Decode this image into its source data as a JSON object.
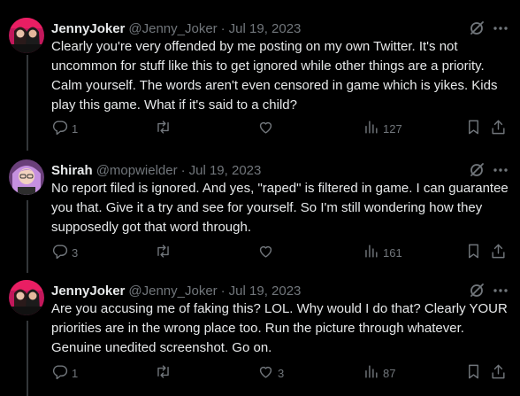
{
  "tweets": [
    {
      "display_name": "JennyJoker",
      "handle": "@Jenny_Joker",
      "separator": "·",
      "date": "Jul 19, 2023",
      "text": "Clearly you're very offended by me posting on my own Twitter. It's not uncommon for stuff like this to get ignored while other things are a priority. Calm yourself. The words aren't even censored in game which is yikes. Kids play this game. What if it's said to a child?",
      "replies": "1",
      "retweets": "",
      "likes": "",
      "views": "127",
      "avatar": "avatar-couple"
    },
    {
      "display_name": "Shirah",
      "handle": "@mopwielder",
      "separator": "·",
      "date": "Jul 19, 2023",
      "text": "No report filed is ignored. And yes, \"raped\" is filtered in game. I can guarantee you that. Give it a try and see for yourself. So I'm still wondering how they supposedly got that word through.",
      "replies": "3",
      "retweets": "",
      "likes": "",
      "views": "161",
      "avatar": "avatar-purple-hair"
    },
    {
      "display_name": "JennyJoker",
      "handle": "@Jenny_Joker",
      "separator": "·",
      "date": "Jul 19, 2023",
      "text": "Are you accusing me of faking this? LOL. Why would I do that? Clearly YOUR priorities are in the wrong place too. Run the picture through whatever. Genuine unedited screenshot. Go on.",
      "replies": "1",
      "retweets": "",
      "likes": "3",
      "views": "87",
      "avatar": "avatar-couple"
    }
  ],
  "icons": {
    "reply": "reply-icon",
    "retweet": "retweet-icon",
    "like": "heart-icon",
    "views": "views-icon",
    "bookmark": "bookmark-icon",
    "share": "share-icon",
    "grok": "grok-icon",
    "more": "more-icon"
  },
  "colors": {
    "background": "#000000",
    "text": "#e7e9ea",
    "secondary": "#71767b",
    "thread_line": "#333639"
  }
}
